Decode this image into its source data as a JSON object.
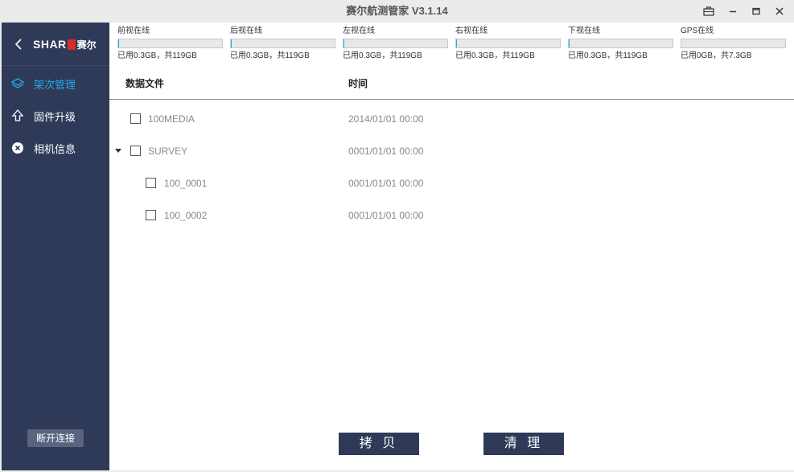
{
  "window": {
    "title": "赛尔航测管家 V3.1.14"
  },
  "brand": {
    "logo_text": "SHAR",
    "logo_cn": "赛尔"
  },
  "sidebar": {
    "items": [
      {
        "label": "架次管理",
        "icon": "layers-icon",
        "active": true
      },
      {
        "label": "固件升级",
        "icon": "upgrade-arrow-icon",
        "active": false
      },
      {
        "label": "相机信息",
        "icon": "camera-info-icon",
        "active": false
      }
    ],
    "disconnect_label": "断开连接"
  },
  "storage": [
    {
      "label": "前视在线",
      "usage": "已用0.3GB，共119GB",
      "fraction": 0.0025
    },
    {
      "label": "后视在线",
      "usage": "已用0.3GB，共119GB",
      "fraction": 0.0025
    },
    {
      "label": "左视在线",
      "usage": "已用0.3GB，共119GB",
      "fraction": 0.0025
    },
    {
      "label": "右视在线",
      "usage": "已用0.3GB，共119GB",
      "fraction": 0.0025
    },
    {
      "label": "下视在线",
      "usage": "已用0.3GB，共119GB",
      "fraction": 0.0025
    },
    {
      "label": "GPS在线",
      "usage": "已用0GB，共7.3GB",
      "fraction": 0
    }
  ],
  "table": {
    "headers": {
      "file": "数据文件",
      "time": "时间"
    },
    "rows": [
      {
        "name": "100MEDIA",
        "time": "2014/01/01 00:00",
        "level": 0,
        "expandable": false,
        "checked": false
      },
      {
        "name": "SURVEY",
        "time": "0001/01/01 00:00",
        "level": 0,
        "expandable": true,
        "expanded": true,
        "checked": false
      },
      {
        "name": "100_0001",
        "time": "0001/01/01 00:00",
        "level": 1,
        "expandable": false,
        "checked": false
      },
      {
        "name": "100_0002",
        "time": "0001/01/01 00:00",
        "level": 1,
        "expandable": false,
        "checked": false
      }
    ]
  },
  "actions": {
    "copy_label": "拷 贝",
    "clean_label": "清 理"
  },
  "colors": {
    "sidebar_bg": "#2f3a59",
    "accent": "#23a9e6",
    "button_bg": "#2f3a59"
  }
}
